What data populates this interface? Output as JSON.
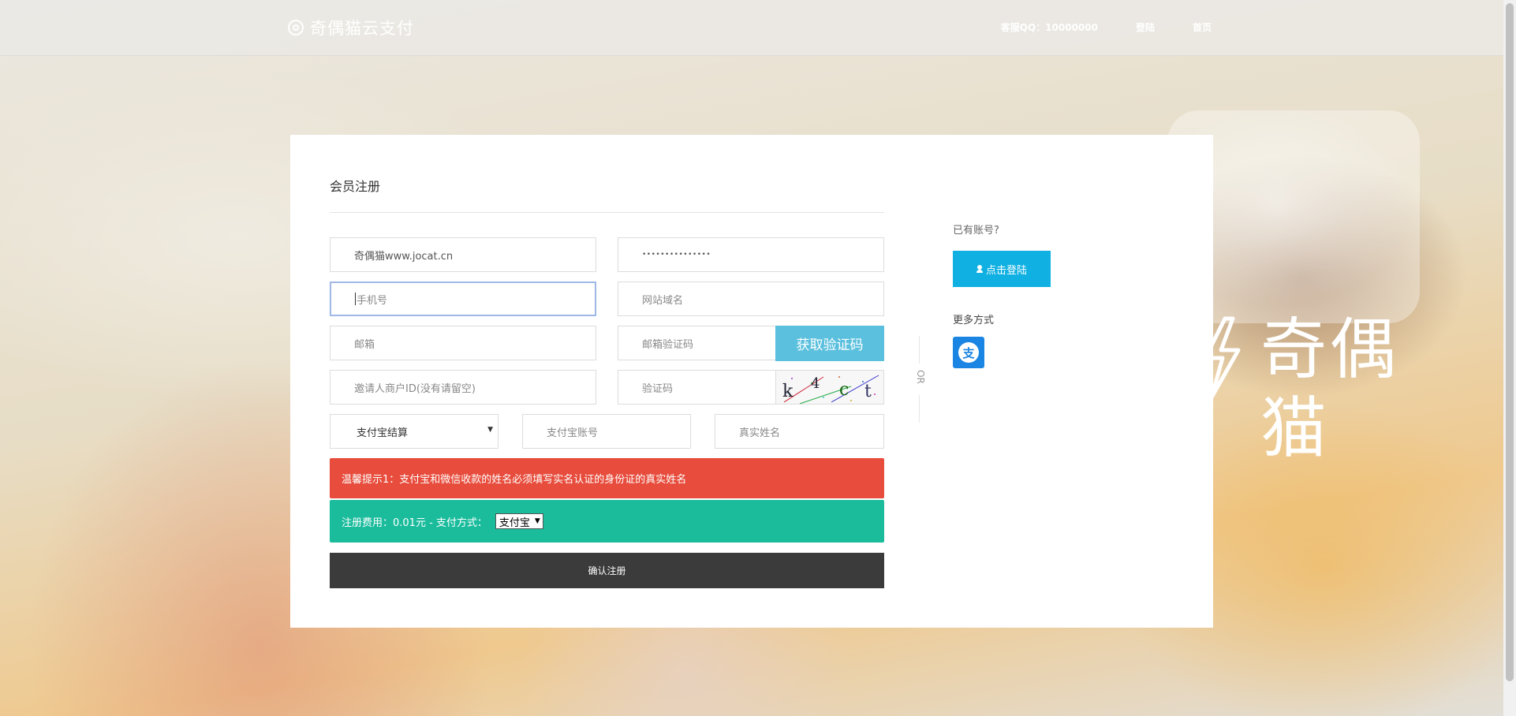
{
  "header": {
    "brand": "奇偶猫云支付",
    "nav": {
      "qq": "客服QQ：10000000",
      "login": "登陆",
      "home": "首页"
    }
  },
  "watermark": {
    "text": "奇偶猫"
  },
  "form": {
    "title": "会员注册",
    "username_value": "奇偶猫www.jocat.cn",
    "password_value": "•••••••••••••••",
    "phone_placeholder": "手机号",
    "domain_placeholder": "网站域名",
    "email_placeholder": "邮箱",
    "email_code_placeholder": "邮箱验证码",
    "get_code_button": "获取验证码",
    "inviter_placeholder": "邀请人商户ID(没有请留空)",
    "captcha_placeholder": "验证码",
    "captcha_chars": [
      "k",
      "4",
      "c",
      "t"
    ],
    "settlement_selected": "支付宝结算",
    "alipay_account_placeholder": "支付宝账号",
    "real_name_placeholder": "真实姓名",
    "tip": "温馨提示1：支付宝和微信收款的姓名必须填写实名认证的身份证的真实姓名",
    "fee_label": "注册费用：0.01元 - 支付方式：",
    "pay_method_selected": "支付宝",
    "submit": "确认注册"
  },
  "divider": {
    "text": "OR"
  },
  "sidebar": {
    "have_account": "已有账号?",
    "login_button": "点击登陆",
    "more_ways": "更多方式",
    "alipay_icon_label": "支"
  },
  "colors": {
    "get_code": "#5bc0de",
    "tip_red": "#e74c3c",
    "fee_green": "#1abc9c",
    "submit_dark": "#3b3b3b",
    "login_blue": "#10b0e2",
    "alipay_blue": "#1a85e2"
  }
}
